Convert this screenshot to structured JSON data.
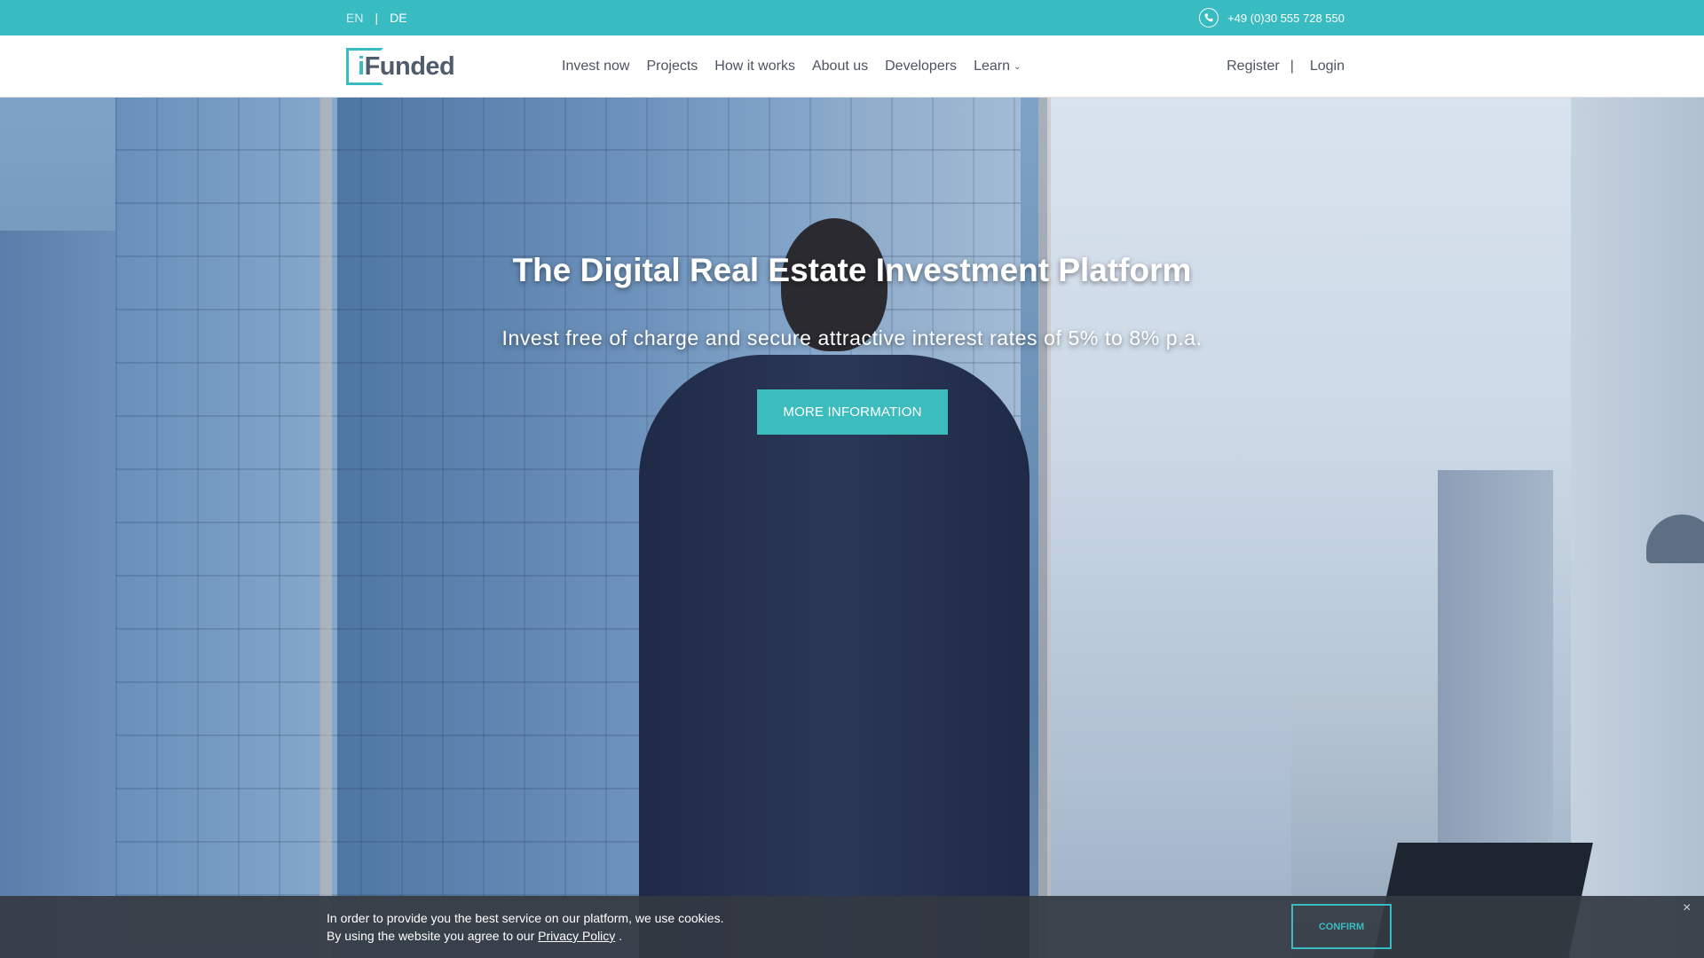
{
  "topbar": {
    "lang_en": "EN",
    "lang_sep": "|",
    "lang_de": "DE",
    "phone": "+49 (0)30 555 728 550",
    "phone_icon": "phone-icon"
  },
  "header": {
    "logo_i": "i",
    "logo_rest": "Funded",
    "nav": [
      "Invest now",
      "Projects",
      "How it works",
      "About us",
      "Developers",
      "Learn"
    ],
    "register": "Register",
    "auth_sep": "|",
    "login": "Login"
  },
  "hero": {
    "title": "The Digital Real Estate Investment Platform",
    "subtitle": "Invest free of charge and secure attractive interest rates of 5% to 8% p.a.",
    "cta": "MORE INFORMATION"
  },
  "cookie": {
    "line1": "In order to provide you the best service on our platform, we use cookies.",
    "line2_prefix": "By using the website you agree to our",
    "privacy_link": "Privacy Policy",
    "line2_suffix": ".",
    "confirm": "CONFIRM",
    "close": "×"
  },
  "colors": {
    "accent": "#39bcc1",
    "cookie_bg": "#343a42",
    "nav_text": "#4d5360"
  }
}
